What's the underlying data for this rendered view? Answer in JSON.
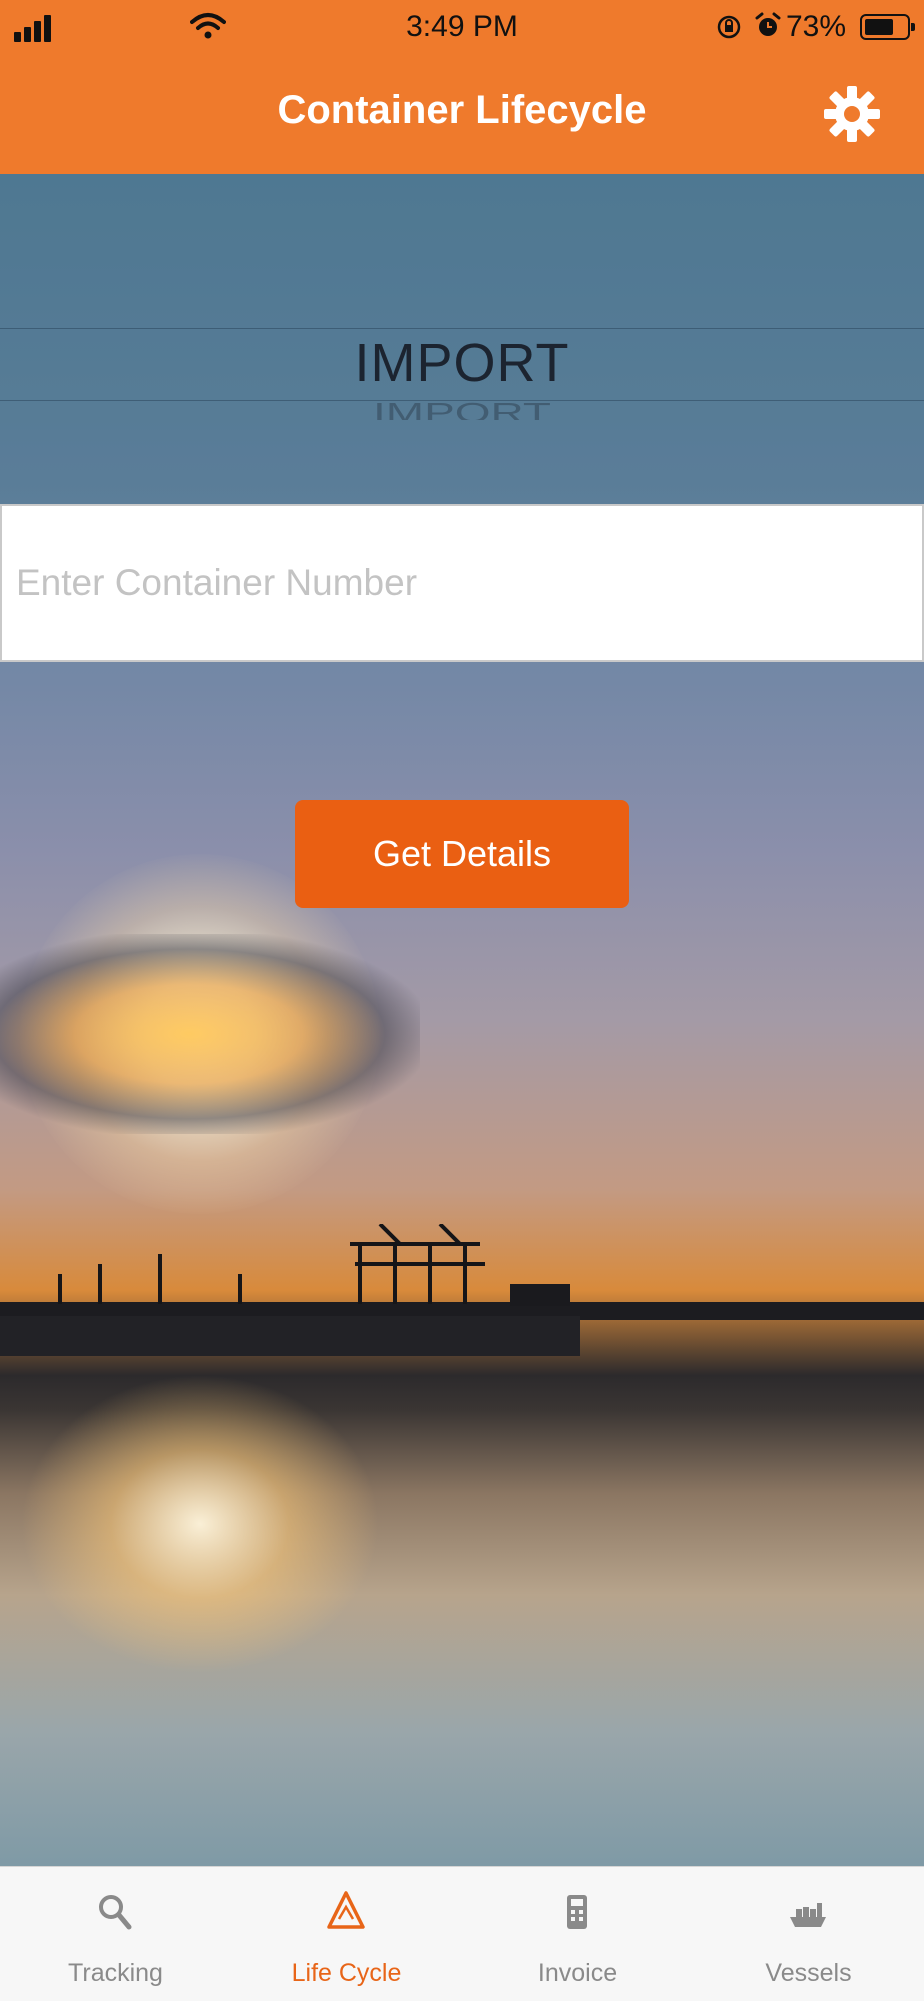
{
  "status_bar": {
    "time": "3:49 PM",
    "battery_percent": "73%",
    "battery_level": 0.73
  },
  "nav": {
    "title": "Container Lifecycle",
    "settings_icon": "gear-icon"
  },
  "picker": {
    "selected": "IMPORT",
    "next": "IMPORT"
  },
  "search": {
    "placeholder": "Enter Container Number",
    "value": ""
  },
  "actions": {
    "get_details_label": "Get Details"
  },
  "colors": {
    "accent": "#ef7a2c",
    "button": "#ea5f12",
    "active_tab": "#e86518",
    "inactive_tab": "#8a8a8a"
  },
  "tabs": [
    {
      "label": "Tracking",
      "icon": "search-icon",
      "active": false
    },
    {
      "label": "Life Cycle",
      "icon": "triangle-icon",
      "active": true
    },
    {
      "label": "Invoice",
      "icon": "invoice-icon",
      "active": false
    },
    {
      "label": "Vessels",
      "icon": "ship-icon",
      "active": false
    }
  ]
}
